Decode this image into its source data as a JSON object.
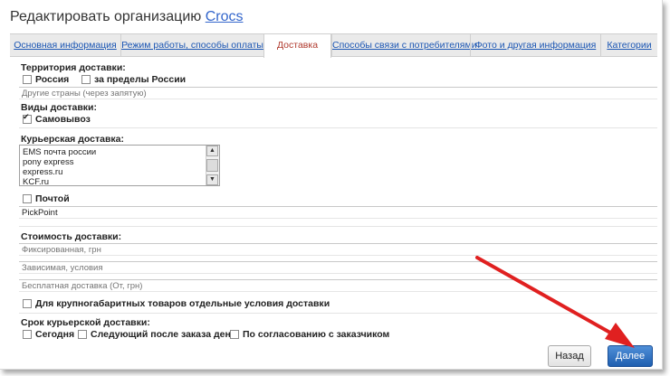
{
  "window": {
    "title_prefix": "Редактировать организацию",
    "title_link": "Crocs"
  },
  "tabs": [
    {
      "label": "Основная информация"
    },
    {
      "label": "Режим работы, способы оплаты"
    },
    {
      "label": "Доставка"
    },
    {
      "label": "Способы связи с потребителями"
    },
    {
      "label": "Фото и другая информация"
    },
    {
      "label": "Категории"
    }
  ],
  "active_tab": "Доставка",
  "territory": {
    "label": "Территория доставки:",
    "options": [
      {
        "label": "Россия",
        "checked": false
      },
      {
        "label": "за пределы России",
        "checked": false
      }
    ],
    "other_countries_placeholder": "Другие страны (через запятую)"
  },
  "delivery_types": {
    "label": "Виды доставки:",
    "pickup": {
      "label": "Самовывоз",
      "checked": true
    }
  },
  "courier": {
    "label": "Курьерская доставка:",
    "list": [
      "EMS почта россии",
      "pony express",
      "express.ru",
      "KCF.ru"
    ]
  },
  "post": {
    "label": "Почтой",
    "checked": false,
    "value": "PickPoint"
  },
  "cost": {
    "label": "Стоимость доставки:",
    "fixed_placeholder": "Фиксированная, грн",
    "dependent_placeholder": "Зависимая, условия",
    "free_placeholder": "Бесплатная доставка (От, грн)",
    "oversize": {
      "label": "Для крупногабаритных товаров отдельные условия доставки",
      "checked": false
    }
  },
  "term": {
    "label": "Срок курьерской доставки:",
    "options": [
      {
        "label": "Сегодня",
        "checked": false
      },
      {
        "label": "Следующий после заказа день",
        "checked": false
      },
      {
        "label": "По согласованию с заказчиком",
        "checked": false
      }
    ]
  },
  "buttons": {
    "back": "Назад",
    "next": "Далее"
  },
  "colors": {
    "link": "#3366cc",
    "active_tab_text": "#b03a2e",
    "primary_button": "#2a6cc0",
    "annotation_arrow": "#e02020"
  }
}
